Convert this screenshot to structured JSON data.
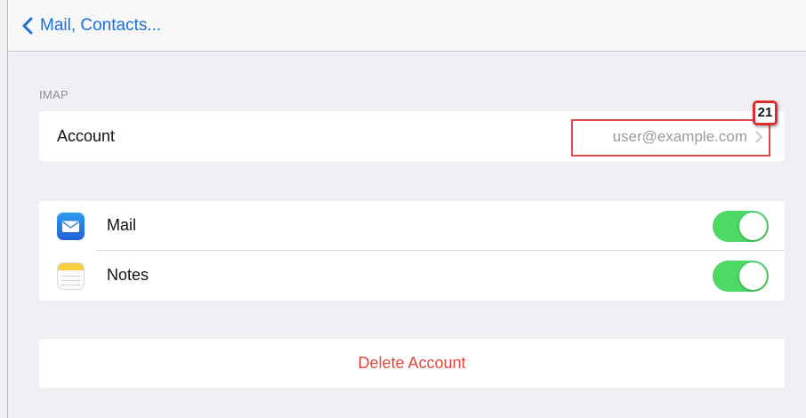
{
  "nav": {
    "back_label": "Mail, Contacts..."
  },
  "section": {
    "header": "IMAP"
  },
  "account": {
    "label": "Account",
    "value": "user@example.com",
    "annotation_badge": "21"
  },
  "services": [
    {
      "label": "Mail",
      "icon": "mail-app-icon",
      "enabled": true
    },
    {
      "label": "Notes",
      "icon": "notes-app-icon",
      "enabled": true
    }
  ],
  "delete_label": "Delete Account",
  "colors": {
    "accent": "#1a6fd8",
    "toggle_on": "#4cd964",
    "destructive": "#e0483e",
    "highlight": "#e34c4c"
  }
}
